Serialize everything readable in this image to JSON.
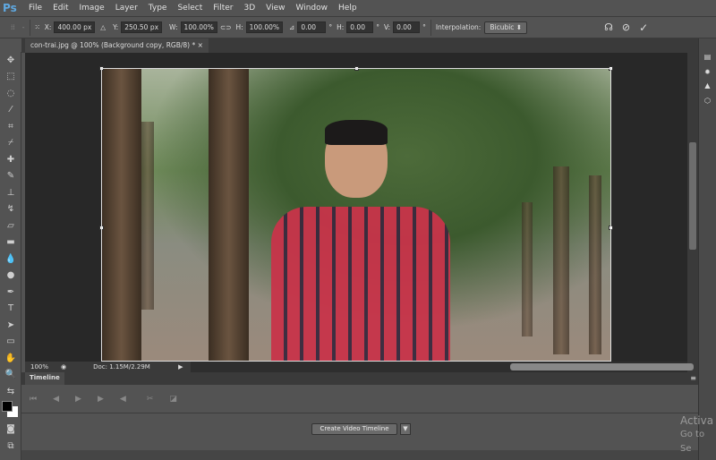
{
  "app": {
    "logo": "Ps"
  },
  "menu": [
    "File",
    "Edit",
    "Image",
    "Layer",
    "Type",
    "Select",
    "Filter",
    "3D",
    "View",
    "Window",
    "Help"
  ],
  "options": {
    "x_label": "X:",
    "x": "400.00 px",
    "y_label": "Y:",
    "y": "250.50 px",
    "w_label": "W:",
    "w": "100.00%",
    "h_label": "H:",
    "h": "100.00%",
    "angle": "0.00",
    "hskew_label": "H:",
    "hskew": "0.00",
    "vskew_label": "V:",
    "vskew": "0.00",
    "interp_label": "Interpolation:",
    "interp": "Bicubic"
  },
  "document": {
    "tab": "con-trai.jpg @ 100% (Background copy, RGB/8) *",
    "close": "×"
  },
  "status": {
    "zoom": "100%",
    "doc": "Doc: 1.15M/2.29M"
  },
  "timeline": {
    "tab": "Timeline",
    "create": "Create Video Timeline"
  },
  "watermark": {
    "line1": "Activa",
    "line2": "Go to Se"
  },
  "colors": {
    "foreground": "#000000",
    "background": "#ffffff",
    "accent": "#5fa8e0"
  }
}
